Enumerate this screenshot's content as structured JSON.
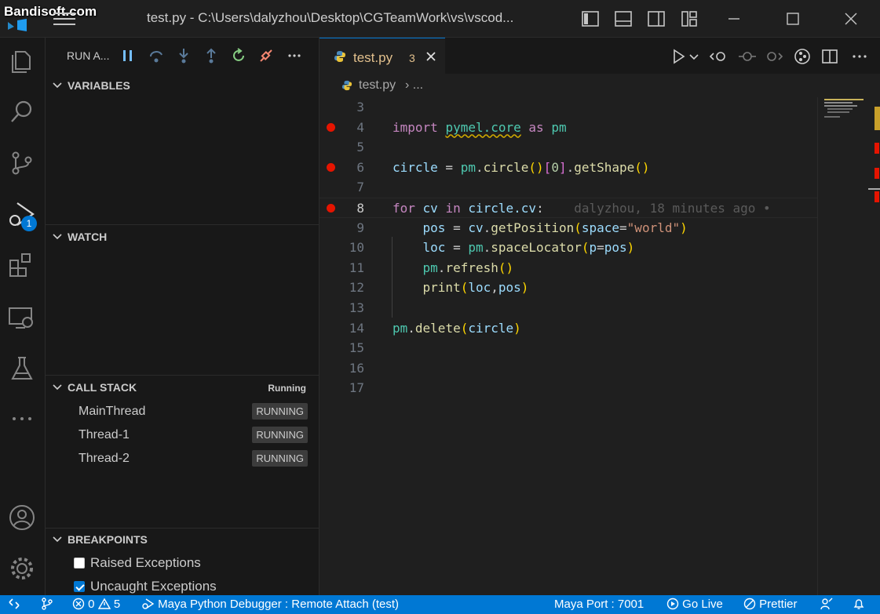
{
  "watermark": "Bandisoft.com",
  "window": {
    "title": "test.py - C:\\Users\\dalyzhou\\Desktop\\CGTeamWork\\vs\\vscod..."
  },
  "activity_bar": {
    "debug_badge": "1"
  },
  "sidebar": {
    "run_label": "RUN A...",
    "sections": {
      "variables": "VARIABLES",
      "watch": "WATCH",
      "call_stack": "CALL STACK",
      "call_stack_state": "Running",
      "breakpoints": "BREAKPOINTS"
    },
    "threads": [
      {
        "name": "MainThread",
        "state": "RUNNING"
      },
      {
        "name": "Thread-1",
        "state": "RUNNING"
      },
      {
        "name": "Thread-2",
        "state": "RUNNING"
      }
    ],
    "breakpoints": [
      {
        "label": "Raised Exceptions",
        "checked": false
      },
      {
        "label": "Uncaught Exceptions",
        "checked": true
      }
    ]
  },
  "editor": {
    "tab": {
      "label": "test.py",
      "problems": "3"
    },
    "breadcrumb": {
      "file": "test.py",
      "sep": "›",
      "more": "..."
    },
    "line_numbers": [
      "3",
      "4",
      "5",
      "6",
      "7",
      "8",
      "9",
      "10",
      "11",
      "12",
      "13",
      "14",
      "15",
      "16",
      "17"
    ],
    "code": {
      "l4": {
        "kw": "import",
        "mod": "pymel.core",
        "as": "as",
        "alias": "pm"
      },
      "l6": {
        "var": "circle",
        "eq": " = ",
        "obj": "pm",
        "dot": ".",
        "fn": "circle",
        "idx": "0",
        "fn2": "getShape"
      },
      "l8": {
        "kw": "for",
        "var": "cv",
        "in": "in",
        "expr": "circle.cv",
        "colon": ":",
        "blame": "dalyzhou, 18 minutes ago •"
      },
      "l9": {
        "var": "pos",
        "obj": "cv",
        "fn": "getPosition",
        "param": "space",
        "str": "\"world\""
      },
      "l10": {
        "var": "loc",
        "obj": "pm",
        "fn": "spaceLocator",
        "param": "p",
        "arg": "pos"
      },
      "l11": {
        "obj": "pm",
        "fn": "refresh"
      },
      "l12": {
        "fn": "print",
        "a1": "loc",
        "a2": "pos"
      },
      "l14": {
        "obj": "pm",
        "fn": "delete",
        "arg": "circle"
      }
    }
  },
  "statusbar": {
    "errors": "0",
    "warnings": "5",
    "debug_config": "Maya Python Debugger : Remote Attach (test)",
    "maya_port": "Maya Port : 7001",
    "go_live": "Go Live",
    "prettier": "Prettier"
  },
  "colors": {
    "accent": "#0078d4",
    "breakpoint": "#e51400",
    "keyword": "#c586c0",
    "variable": "#9cdcfe",
    "function": "#dcdcaa",
    "string": "#ce9178"
  }
}
